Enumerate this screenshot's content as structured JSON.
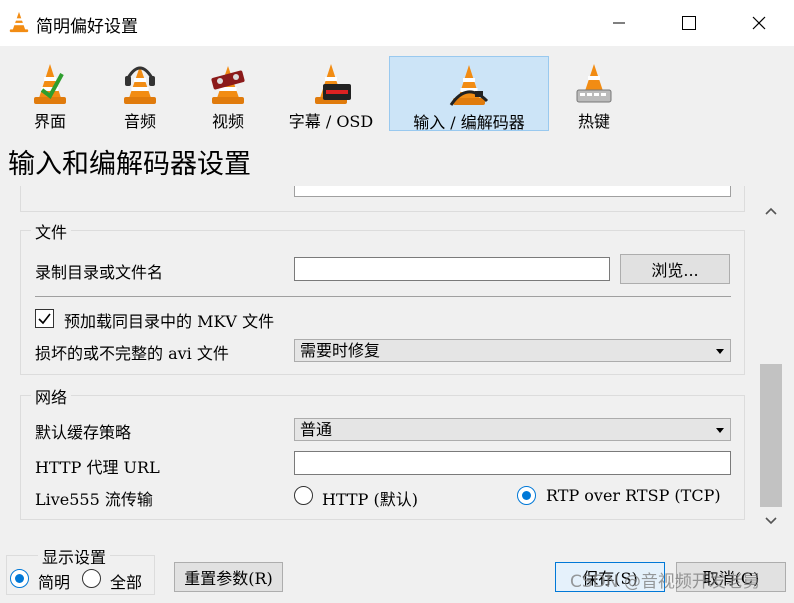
{
  "window": {
    "title": "简明偏好设置"
  },
  "toolbar": {
    "items": [
      {
        "label": "界面",
        "icon": "vlc-cone-icon"
      },
      {
        "label": "音频",
        "icon": "headphones-cone-icon"
      },
      {
        "label": "视频",
        "icon": "film-cone-icon"
      },
      {
        "label": "字幕 / OSD",
        "icon": "subtitle-cone-icon"
      },
      {
        "label": "输入 / 编解码器",
        "icon": "cable-cone-icon",
        "active": true
      },
      {
        "label": "热键",
        "icon": "keyboard-cone-icon"
      }
    ]
  },
  "page": {
    "title": "输入和编解码器设置"
  },
  "files": {
    "title": "文件",
    "record_label": "录制目录或文件名",
    "record_value": "",
    "browse_label": "浏览...",
    "mkv_label": "预加载同目录中的 MKV 文件",
    "mkv_checked": true,
    "avi_label": "损坏的或不完整的 avi 文件",
    "avi_value": "需要时修复"
  },
  "network": {
    "title": "网络",
    "cache_label": "默认缓存策略",
    "cache_value": "普通",
    "proxy_label": "HTTP 代理 URL",
    "proxy_value": "",
    "live555_label": "Live555 流传输",
    "http_option": "HTTP (默认)",
    "rtsp_option": "RTP over RTSP (TCP)",
    "selected": "rtsp"
  },
  "display": {
    "title": "显示设置",
    "simple_label": "简明",
    "all_label": "全部",
    "selected": "simple"
  },
  "buttons": {
    "reset_label": "重置参数(R)",
    "save_label": "保存(S)",
    "cancel_label": "取消(C)"
  },
  "watermark": "CSDN @音视频开发老舅",
  "colors": {
    "accent": "#0078d7",
    "active_tab": "#cce4f7",
    "vlc_orange": "#f28c13"
  }
}
